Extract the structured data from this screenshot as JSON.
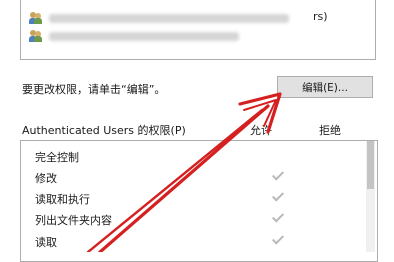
{
  "group_list": {
    "rows": [
      {
        "suffix": "rs)"
      },
      {
        "suffix": ""
      }
    ]
  },
  "change_hint": "要更改权限，请单击“编辑”。",
  "edit_button_label": "编辑(E)...",
  "permissions": {
    "header": "Authenticated Users 的权限(P)",
    "col_allow": "允许",
    "col_deny": "拒绝",
    "rows": [
      {
        "name": "完全控制",
        "allow": false,
        "deny": false
      },
      {
        "name": "修改",
        "allow": true,
        "deny": false
      },
      {
        "name": "读取和执行",
        "allow": true,
        "deny": false
      },
      {
        "name": "列出文件夹内容",
        "allow": true,
        "deny": false
      },
      {
        "name": "读取",
        "allow": true,
        "deny": false
      }
    ]
  },
  "annotation_color": "#d42020"
}
